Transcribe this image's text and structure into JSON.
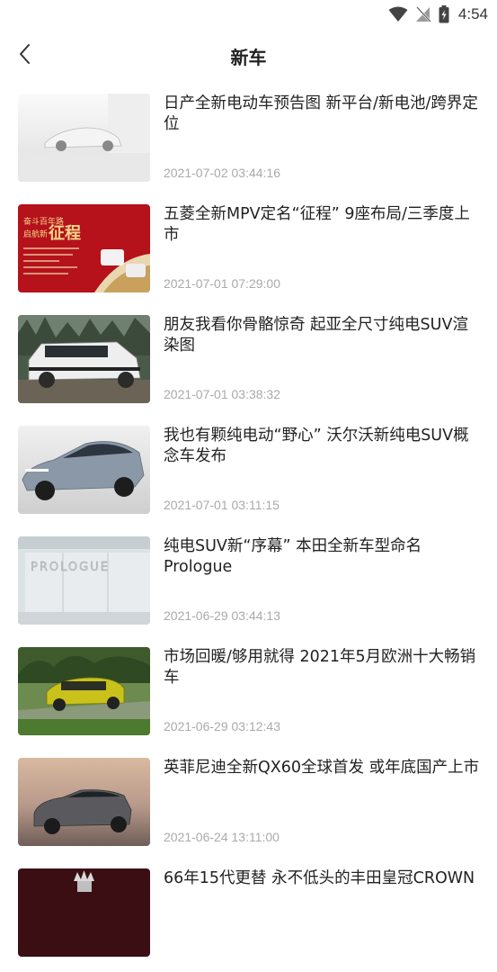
{
  "status_bar": {
    "time": "4:54",
    "icons": [
      "wifi-icon",
      "no-signal-icon",
      "battery-icon"
    ]
  },
  "header": {
    "title": "新车",
    "back_icon": "chevron-left-icon"
  },
  "colors": {
    "title_text": "#222222",
    "date_text": "#aaaaaa",
    "background": "#ffffff"
  },
  "articles": [
    {
      "title": "日产全新电动车预告图 新平台/新电池/跨界定位",
      "date": "2021-07-02 03:44:16"
    },
    {
      "title": "五菱全新MPV定名“征程” 9座布局/三季度上市",
      "date": "2021-07-01 07:29:00",
      "thumb_text": {
        "line1": "奋斗百年路",
        "line2": "启航新",
        "big": "征程"
      }
    },
    {
      "title": "朋友我看你骨骼惊奇 起亚全尺寸纯电SUV渲染图",
      "date": "2021-07-01 03:38:32"
    },
    {
      "title": "我也有颗纯电动“野心” 沃尔沃新纯电SUV概念车发布",
      "date": "2021-07-01 03:11:15"
    },
    {
      "title": "纯电SUV新“序幕” 本田全新车型命名Prologue",
      "date": "2021-06-29 03:44:13",
      "thumb_text": {
        "sign": "PROLOGUE"
      }
    },
    {
      "title": "市场回暖/够用就得 2021年5月欧洲十大畅销车",
      "date": "2021-06-29 03:12:43"
    },
    {
      "title": "英菲尼迪全新QX60全球首发 或年底国产上市",
      "date": "2021-06-24 13:11:00"
    },
    {
      "title": "66年15代更替 永不低头的丰田皇冠CROWN",
      "date": ""
    }
  ]
}
